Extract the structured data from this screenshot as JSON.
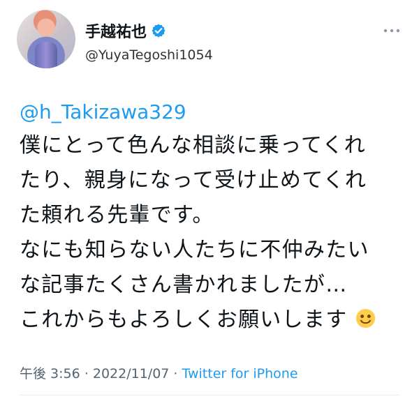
{
  "tweet": {
    "display_name": "手越祐也",
    "handle": "@YuyaTegoshi1054",
    "mention": "@h_Takizawa329",
    "lines": [
      "僕にとって色んな相談に乗ってくれ",
      "たり、親身になって受け止めてくれ",
      "た頼れる先輩です。",
      "なにも知らない人たちに不仲みたい",
      "な記事たくさん書かれましたが…",
      "これからもよろしくお願いします"
    ],
    "time": "午後 3:56",
    "date": "2022/11/07",
    "separator": "·",
    "source": "Twitter for iPhone"
  },
  "icons": {
    "verified": "verified-badge-icon",
    "more": "more-options-icon",
    "emoji": "smiling-face-emoji"
  },
  "colors": {
    "accent": "#1d9bf0",
    "text": "#0f1419",
    "muted": "#536471"
  }
}
